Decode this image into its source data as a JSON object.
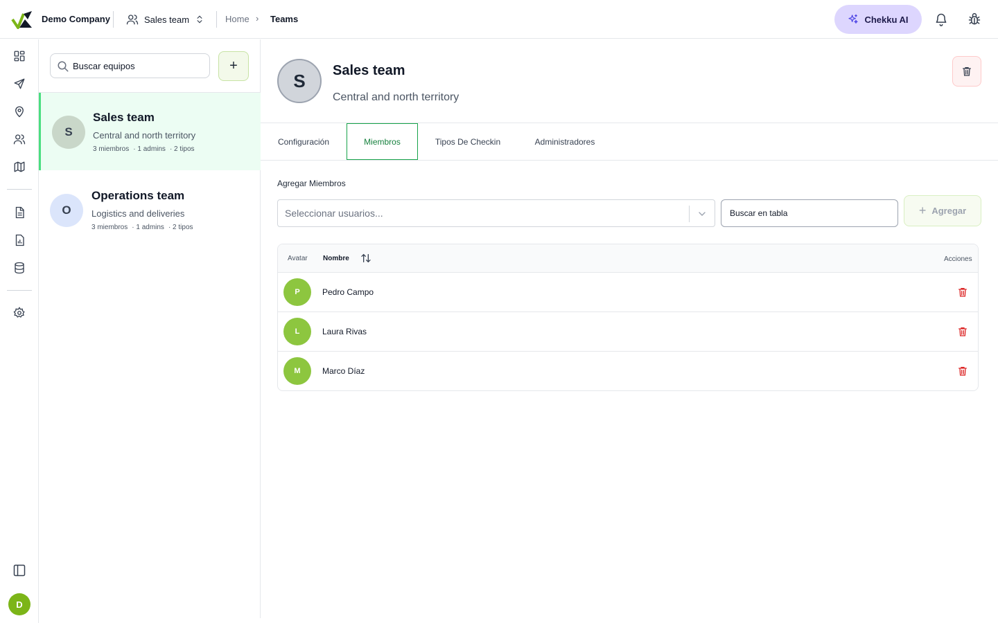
{
  "topbar": {
    "company": "Demo Company",
    "team_switcher": "Sales team",
    "breadcrumb": {
      "home": "Home",
      "separator": "›",
      "current": "Teams"
    },
    "ai_button": "Chekku AI"
  },
  "colors": {
    "accent_green": "#16a34a",
    "brand_lime": "#8dc63f",
    "ai_purple": "#ddd6fe",
    "danger": "#dc2626"
  },
  "rail": {
    "icons": [
      "dashboard-icon",
      "send-icon",
      "map-pin-icon",
      "users-icon",
      "map-icon",
      "document-icon",
      "report-icon",
      "database-icon",
      "settings-icon",
      "sidebar-toggle-icon"
    ],
    "user_initial": "D"
  },
  "teams_panel": {
    "search_placeholder": "Buscar equipos",
    "add_label": "+",
    "teams": [
      {
        "initial": "S",
        "name": "Sales team",
        "description": "Central and north territory",
        "members": "3 miembros",
        "admins": "· 1 admins",
        "types": "· 2 tipos"
      },
      {
        "initial": "O",
        "name": "Operations team",
        "description": "Logistics and deliveries",
        "members": "3 miembros",
        "admins": "· 1 admins",
        "types": "· 2 tipos"
      }
    ]
  },
  "detail": {
    "initial": "S",
    "title": "Sales team",
    "description": "Central and north territory",
    "tabs": [
      {
        "label": "Configuración"
      },
      {
        "label": "Miembros"
      },
      {
        "label": "Tipos De Checkin"
      },
      {
        "label": "Administradores"
      }
    ],
    "active_tab": "Miembros",
    "add_members_label": "Agregar Miembros",
    "select_placeholder": "Seleccionar usuarios...",
    "table_search_placeholder": "Buscar en tabla",
    "add_button": "Agregar",
    "add_icon": "+",
    "table": {
      "columns": {
        "avatar": "Avatar",
        "name": "Nombre",
        "actions": "Acciones"
      },
      "rows": [
        {
          "initial": "P",
          "name": "Pedro Campo"
        },
        {
          "initial": "L",
          "name": "Laura Rivas"
        },
        {
          "initial": "M",
          "name": "Marco Díaz"
        }
      ]
    }
  }
}
